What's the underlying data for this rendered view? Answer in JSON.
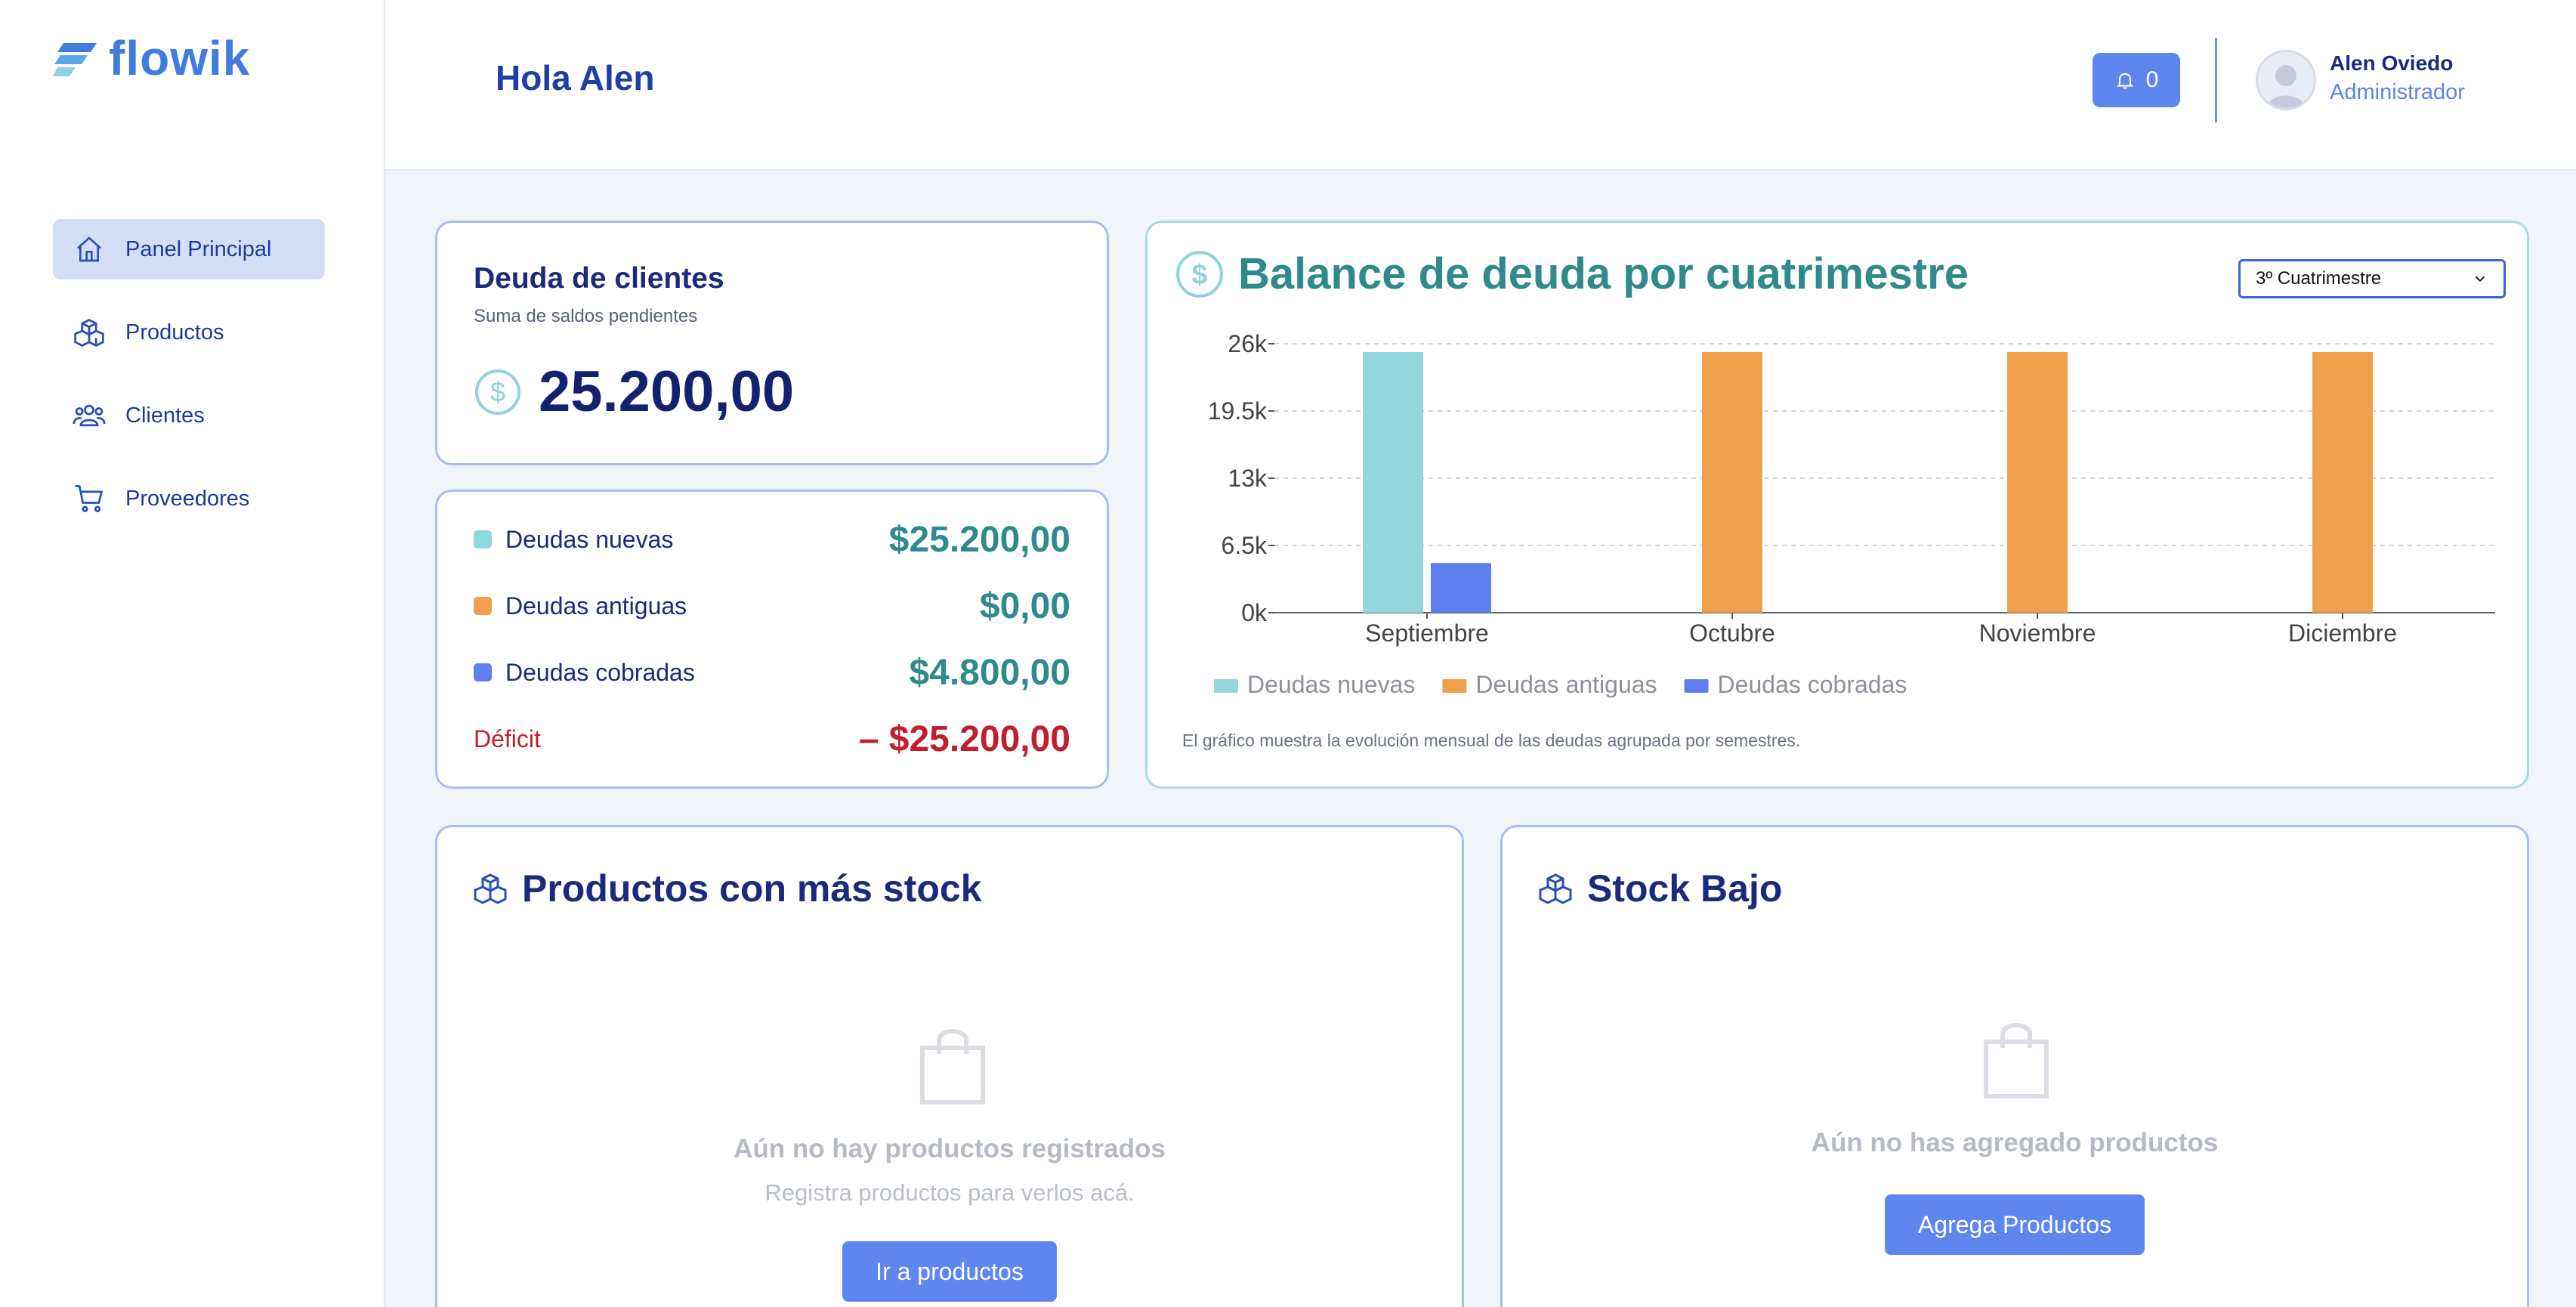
{
  "app": {
    "logo": "flowik"
  },
  "sidebar": {
    "items": [
      {
        "label": "Panel Principal",
        "icon": "home-icon",
        "active": true
      },
      {
        "label": "Productos",
        "icon": "boxes-icon"
      },
      {
        "label": "Clientes",
        "icon": "users-icon"
      },
      {
        "label": "Proveedores",
        "icon": "cart-icon"
      }
    ]
  },
  "header": {
    "greeting": "Hola Alen",
    "notifications": "0",
    "user_name": "Alen Oviedo",
    "user_role": "Administrador"
  },
  "debt_card": {
    "title": "Deuda de clientes",
    "subtitle": "Suma de saldos pendientes",
    "amount": "25.200,00"
  },
  "summary": {
    "rows": [
      {
        "label": "Deudas nuevas",
        "value": "$25.200,00",
        "color": "#94d6de"
      },
      {
        "label": "Deudas antiguas",
        "value": "$0,00",
        "color": "#f0a04b"
      },
      {
        "label": "Deudas cobradas",
        "value": "$4.800,00",
        "color": "#5f7fee"
      }
    ],
    "deficit_label": "Déficit",
    "deficit_value": "– $25.200,00"
  },
  "chart": {
    "title": "Balance de deuda por cuatrimestre",
    "period": "3º Cuatrimestre",
    "note": "El gráfico muestra la evolución mensual de las deudas agrupada por semestres."
  },
  "chart_data": {
    "type": "bar",
    "categories": [
      "Septiembre",
      "Octubre",
      "Noviembre",
      "Diciembre"
    ],
    "series": [
      {
        "name": "Deudas nuevas",
        "values": [
          25200,
          0,
          0,
          0
        ],
        "color": "#94d6de"
      },
      {
        "name": "Deudas antiguas",
        "values": [
          0,
          25200,
          25200,
          25200
        ],
        "color": "#f0a04b"
      },
      {
        "name": "Deudas cobradas",
        "values": [
          4800,
          0,
          0,
          0
        ],
        "color": "#5f7fee"
      }
    ],
    "yticks": [
      "0k",
      "6.5k",
      "13k",
      "19.5k",
      "26k"
    ],
    "ytick_values": [
      0,
      6500,
      13000,
      19500,
      26000
    ],
    "ylim": [
      0,
      26000
    ],
    "grid": true,
    "legend_position": "bottom-left"
  },
  "top_stock": {
    "title": "Productos con más stock",
    "empty_title": "Aún no hay productos registrados",
    "empty_subtitle": "Registra productos para verlos acá.",
    "button": "Ir a productos"
  },
  "low_stock": {
    "title": "Stock Bajo",
    "empty_title": "Aún no has agregado productos",
    "button": "Agrega Productos"
  }
}
